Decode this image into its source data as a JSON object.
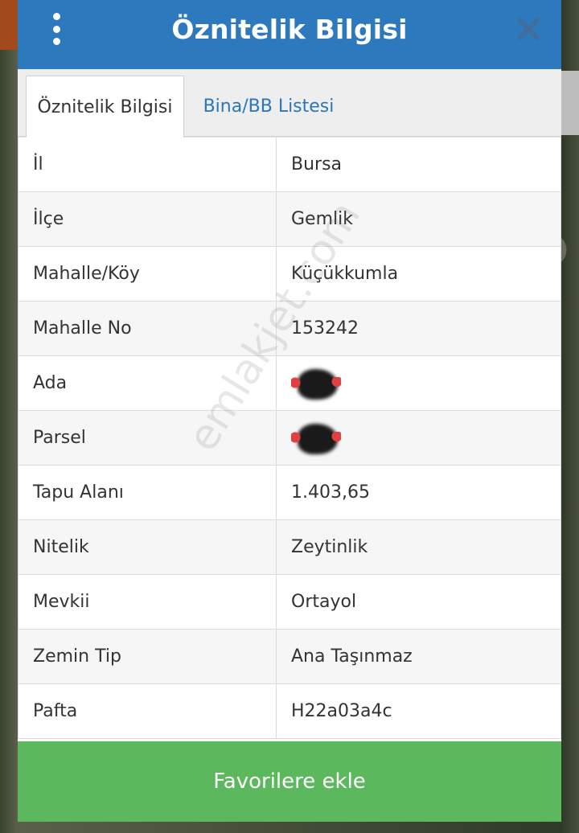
{
  "header": {
    "title": "Öznitelik Bilgisi",
    "menu_icon": "more-vertical-icon",
    "close_icon": "close-icon"
  },
  "tabs": [
    {
      "label": "Öznitelik Bilgisi",
      "active": true
    },
    {
      "label": "Bina/BB Listesi",
      "active": false
    }
  ],
  "attributes": [
    {
      "key": "İl",
      "value": "Bursa"
    },
    {
      "key": "İlçe",
      "value": "Gemlik"
    },
    {
      "key": "Mahalle/Köy",
      "value": "Küçükkumla"
    },
    {
      "key": "Mahalle No",
      "value": "153242"
    },
    {
      "key": "Ada",
      "value": ""
    },
    {
      "key": "Parsel",
      "value": ""
    },
    {
      "key": "Tapu Alanı",
      "value": "1.403,65"
    },
    {
      "key": "Nitelik",
      "value": "Zeytinlik"
    },
    {
      "key": "Mevkii",
      "value": "Ortayol"
    },
    {
      "key": "Zemin Tip",
      "value": "Ana Taşınmaz"
    },
    {
      "key": "Pafta",
      "value": "H22a03a4c"
    }
  ],
  "watermark": "emlakjet.com",
  "footer": {
    "button_label": "Favorilere ekle"
  },
  "colors": {
    "header": "#2d79be",
    "tab_link": "#2a76b8",
    "button": "#5cb85c"
  }
}
